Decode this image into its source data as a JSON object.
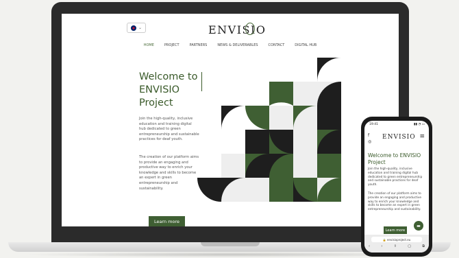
{
  "site": {
    "language": "EN",
    "logo": "ENVISIO",
    "nav": [
      "HOME",
      "PROJECT",
      "PARTNERS",
      "NEWS & DELIVERABLES",
      "CONTACT",
      "DIGITAL HUB"
    ],
    "hero_title": "Welcome to ENVISIO Project",
    "hero_p1": "Join the high-quality, inclusive education and training digital hub dedicated to green entrepreneurship and sustainable practices for deaf youth.",
    "hero_p2": "The creation of our platform aims to provide an engaging and productive way to enrich your knowledge and skills to become an expert in green entrepreneurship and sustainability.",
    "cta": "Learn more"
  },
  "phone": {
    "time": "19:41",
    "status_icons": "▮▮ ◔ ▭",
    "social": [
      "f",
      "◎"
    ],
    "logo": "ENVISIO",
    "menu_icon": "≡",
    "title": "Welcome to ENVISIO Project",
    "p1": "Join the high-quality, inclusive education and training digital hub dedicated to green entrepreneurship and sustainable practices for deaf youth.",
    "p2": "The creation of our platform aims to provide an engaging and productive way to enrich your knowledge and skills to become an expert in green entrepreneurship and sustainability.",
    "cta": "Learn more",
    "chat_icon": "▬",
    "url": "🔒 envisioproject.eu",
    "tools": [
      "‹",
      "›",
      "⇪",
      "▢",
      "⧉"
    ]
  },
  "colors": {
    "green": "#3f5f33",
    "dark": "#1e1e1e",
    "light": "#eeeeee"
  }
}
